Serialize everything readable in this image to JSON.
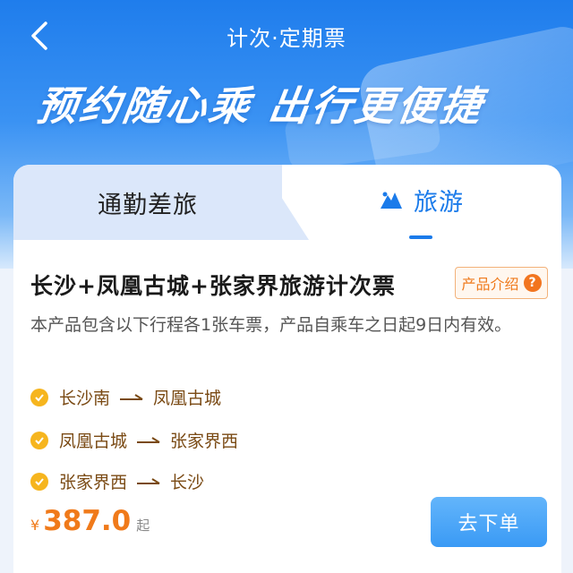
{
  "header": {
    "title": "计次·定期票",
    "slogan": "预约随心乘 出行更便捷"
  },
  "tabs": [
    {
      "label": "通勤差旅",
      "active": false
    },
    {
      "label": "旅游",
      "active": true,
      "icon": "mountain-icon"
    }
  ],
  "product": {
    "title": "长沙+凤凰古城+张家界旅游计次票",
    "intro_label": "产品介绍",
    "description": "本产品包含以下行程各1张车票，产品自乘车之日起9日内有效。",
    "routes": [
      {
        "from": "长沙南",
        "to": "凤凰古城"
      },
      {
        "from": "凤凰古城",
        "to": "张家界西"
      },
      {
        "from": "张家界西",
        "to": "长沙"
      }
    ],
    "currency": "¥",
    "price": "387.0",
    "price_suffix": "起",
    "order_label": "去下单"
  },
  "colors": {
    "brand_blue": "#1b7bea",
    "accent_orange": "#f07a1a",
    "route_brown": "#7a4a14",
    "check_yellow": "#f6b51e"
  }
}
